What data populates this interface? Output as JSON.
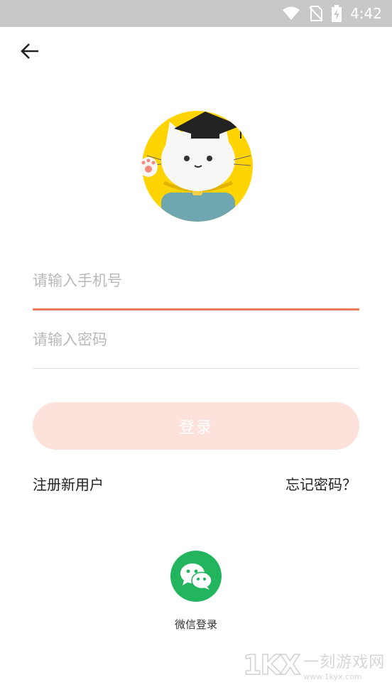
{
  "status_bar": {
    "time": "4:42",
    "icons": [
      "wifi-icon",
      "no-sim-icon",
      "battery-charging-icon"
    ]
  },
  "nav": {
    "back_icon": "arrow-left-icon"
  },
  "avatar": {
    "description_icon": "cat-graduate-mascot",
    "ring_color": "#ffd400"
  },
  "form": {
    "phone_placeholder": "请输入手机号",
    "phone_value": "",
    "password_placeholder": "请输入密码",
    "password_value": "",
    "login_label": "登录"
  },
  "links": {
    "register": "注册新用户",
    "forgot": "忘记密码？"
  },
  "wechat": {
    "label": "微信登录",
    "icon": "wechat-icon",
    "color": "#23b45e"
  },
  "watermark": {
    "logo": "1KX",
    "name": "一刻游戏网",
    "url": "www.1kyx.com"
  },
  "colors": {
    "accent": "#ec7b5a",
    "login_button_bg": "#fde2dc"
  }
}
